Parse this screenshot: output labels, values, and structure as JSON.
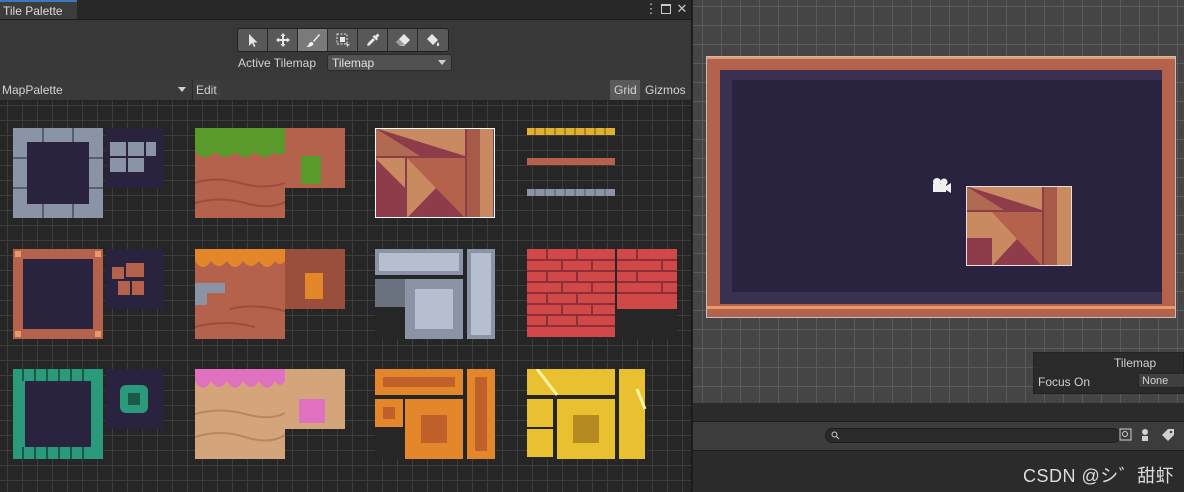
{
  "palette_window": {
    "tab_title": "Tile Palette",
    "menu_icon": "kebab-menu-icon",
    "maximize_icon": "window-maximize-icon",
    "close_icon": "close-icon"
  },
  "toolbar": {
    "tools": [
      {
        "name": "select-tool",
        "icon": "arrow-pointer-icon",
        "active": false
      },
      {
        "name": "move-tool",
        "icon": "move-arrows-icon",
        "active": false
      },
      {
        "name": "paint-tool",
        "icon": "paintbrush-icon",
        "active": true
      },
      {
        "name": "box-fill-tool",
        "icon": "box-fill-icon",
        "active": false
      },
      {
        "name": "picker-tool",
        "icon": "eyedropper-icon",
        "active": false
      },
      {
        "name": "erase-tool",
        "icon": "eraser-icon",
        "active": false
      },
      {
        "name": "flood-fill-tool",
        "icon": "paint-bucket-icon",
        "active": false
      }
    ]
  },
  "active_tilemap": {
    "label": "Active Tilemap",
    "value": "Tilemap"
  },
  "palette_bar": {
    "palette_name": "MapPalette",
    "edit_label": "Edit",
    "grid_label": "Grid",
    "gizmos_label": "Gizmos"
  },
  "scene": {
    "overlay_title": "Tilemap",
    "focus_label": "Focus On",
    "focus_value": "None",
    "camera_icon": "camera-gizmo-icon"
  },
  "bottom_toolbar": {
    "search_icon": "search-icon",
    "icons": [
      "search-by-type-icon",
      "search-by-label-icon",
      "tag-icon"
    ]
  },
  "watermark": "CSDN @シ゛甜虾",
  "colors": {
    "selection_blue": "#3a79bb",
    "active_tool": "#7a7a7a",
    "wood": "#b5624c",
    "navy": "#2a2340"
  }
}
